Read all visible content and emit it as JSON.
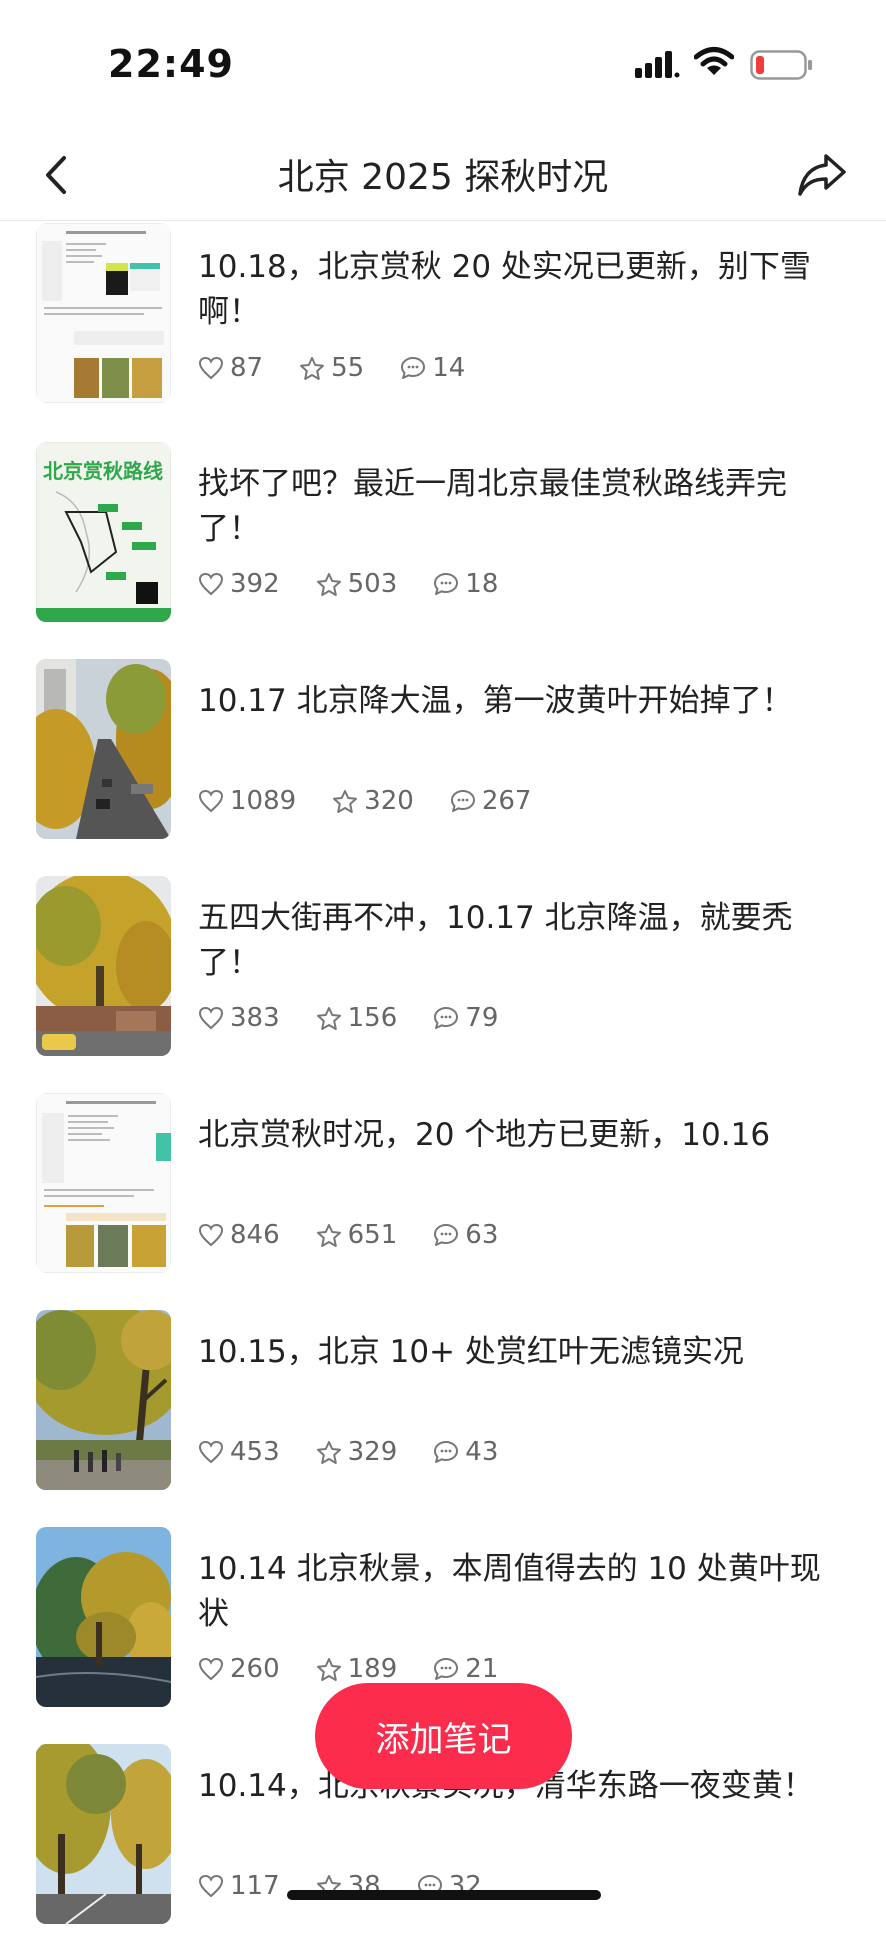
{
  "status_bar": {
    "time": "22:49"
  },
  "nav": {
    "title": "北京 2025 探秋时况"
  },
  "notes": [
    {
      "title": "10.18，北京赏秋 20 处实况已更新，别下雪啊！",
      "likes": "87",
      "collects": "55",
      "comments": "14"
    },
    {
      "title": "找坏了吧？最近一周北京最佳赏秋路线弄完了！",
      "likes": "392",
      "collects": "503",
      "comments": "18",
      "thumb_text": "北京赏秋路线"
    },
    {
      "title": "10.17 北京降大温，第一波黄叶开始掉了！",
      "likes": "1089",
      "collects": "320",
      "comments": "267"
    },
    {
      "title": "五四大街再不冲，10.17 北京降温，就要秃了！",
      "likes": "383",
      "collects": "156",
      "comments": "79"
    },
    {
      "title": "北京赏秋时况，20 个地方已更新，10.16",
      "likes": "846",
      "collects": "651",
      "comments": "63"
    },
    {
      "title": "10.15，北京 10+ 处赏红叶无滤镜实况",
      "likes": "453",
      "collects": "329",
      "comments": "43"
    },
    {
      "title": "10.14 北京秋景，本周值得去的 10 处黄叶现状",
      "likes": "260",
      "collects": "189",
      "comments": "21"
    },
    {
      "title": "10.14，北京秋景实况，清华东路一夜变黄！",
      "likes": "117",
      "collects": "38",
      "comments": "32"
    }
  ],
  "fab": {
    "label": "添加笔记"
  },
  "colors": {
    "accent": "#fb2c4c",
    "battery_low": "#f23b3b"
  }
}
